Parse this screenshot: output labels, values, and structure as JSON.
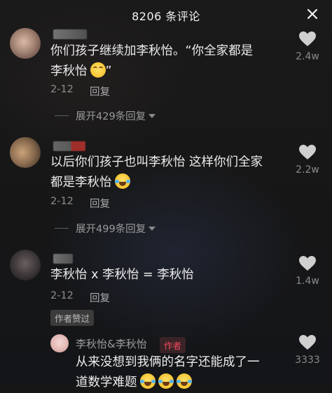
{
  "header": {
    "title": "8206 条评论",
    "close_icon": "close-icon"
  },
  "comments": [
    {
      "text_line1": "你们孩子继续加李秋怡。“你全家都是",
      "text_line2": "李秋怡",
      "text_suffix": "”",
      "date": "2-12",
      "reply_label": "回复",
      "likes": "2.4w",
      "expand_label": "展开429条回复"
    },
    {
      "text_line1": "以后你们孩子也叫李秋怡 这样你们全家",
      "text_line2": "都是李秋怡",
      "date": "2-12",
      "reply_label": "回复",
      "likes": "2.2w",
      "expand_label": "展开499条回复"
    },
    {
      "text_line1": "李秋怡 x 李秋怡 = 李秋怡",
      "date": "2-12",
      "reply_label": "回复",
      "likes": "1.4w",
      "badge": "作者赞过"
    }
  ],
  "reply": {
    "author": "李秋怡&李秋怡",
    "author_badge": "作者",
    "text_line1": "从来没想到我俩的名字还能成了一",
    "text_line2": "道数学难题",
    "likes": "3333"
  },
  "colors": {
    "author_badge": "#ee4a5a",
    "background": "#161616"
  }
}
